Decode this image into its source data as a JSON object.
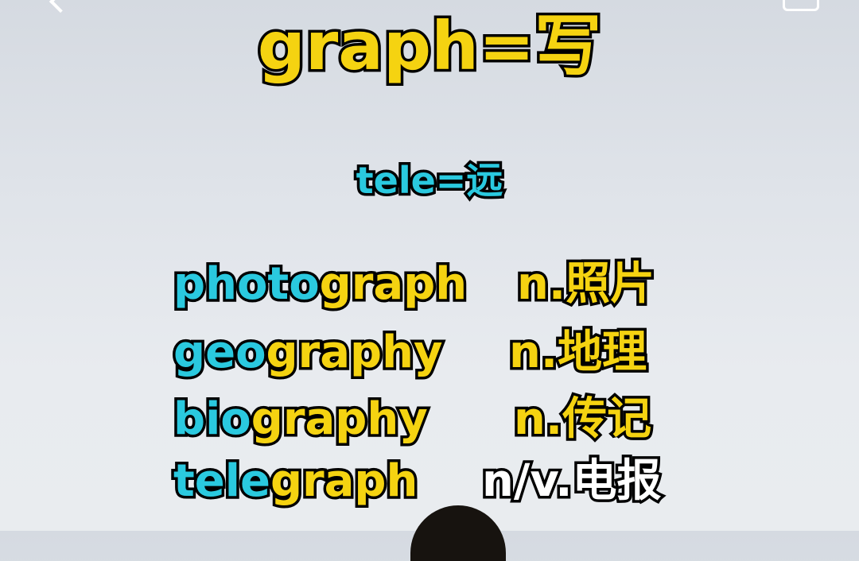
{
  "title": "graph=写",
  "subtitle": "tele=远",
  "words": [
    {
      "prefix": "photo",
      "root": "graph",
      "suffix": "",
      "meaning": "n.照片"
    },
    {
      "prefix": "geo",
      "root": "graph",
      "suffix": "y",
      "meaning": "n.地理"
    },
    {
      "prefix": "bio",
      "root": "graph",
      "suffix": "y",
      "meaning": "n.传记"
    },
    {
      "prefix": "tele",
      "root": "graph",
      "suffix": "",
      "meaning": "n/v.电报"
    }
  ],
  "colors": {
    "highlight": "#2ac9df",
    "accent": "#f5d311",
    "outline": "#000000"
  },
  "icons": {
    "back": "back-chevron-icon",
    "corner": "window-icon"
  }
}
